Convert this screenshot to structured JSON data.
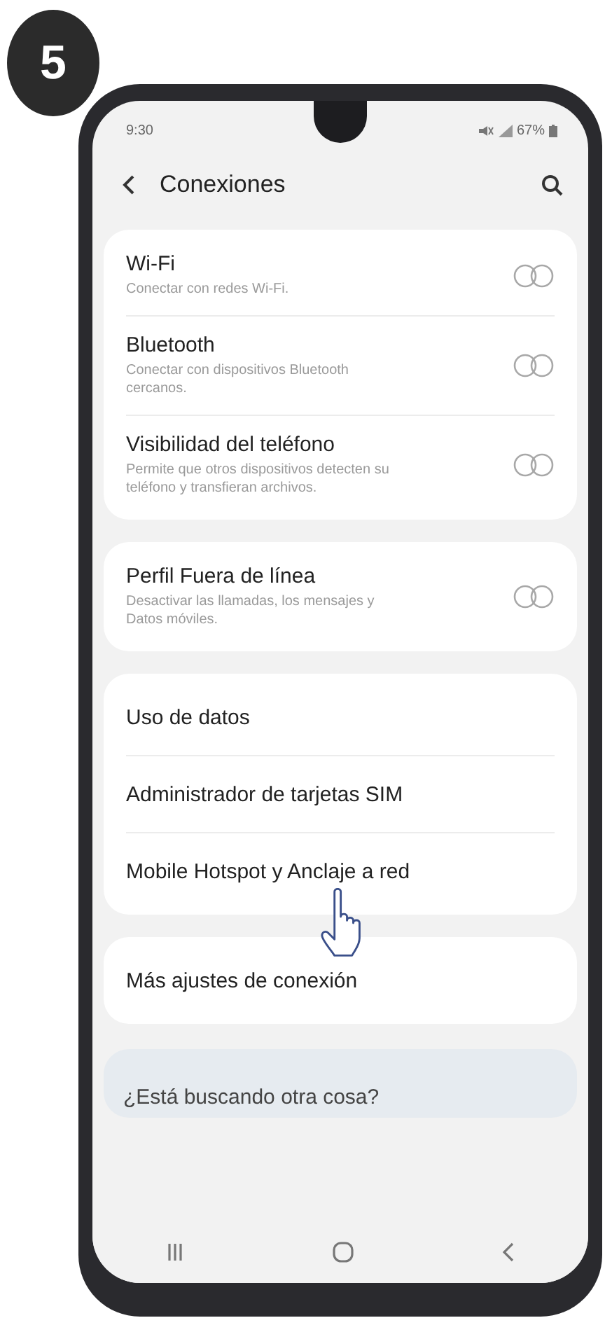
{
  "step_badge": "5",
  "status_bar": {
    "time": "9:30",
    "battery": "67%"
  },
  "header": {
    "title": "Conexiones"
  },
  "groups": [
    {
      "items": [
        {
          "kind": "toggle",
          "title": "Wi-Fi",
          "subtitle": "Conectar con redes Wi-Fi.",
          "on": false
        },
        {
          "kind": "toggle",
          "title": "Bluetooth",
          "subtitle": "Conectar con dispositivos Bluetooth cercanos.",
          "on": false
        },
        {
          "kind": "toggle",
          "title": "Visibilidad del teléfono",
          "subtitle": "Permite que otros dispositivos detecten su teléfono y transfieran archivos.",
          "on": false
        }
      ]
    },
    {
      "items": [
        {
          "kind": "toggle",
          "title": "Perfil Fuera de línea",
          "subtitle": "Desactivar las llamadas, los mensajes y Datos móviles.",
          "on": false
        }
      ]
    },
    {
      "items": [
        {
          "kind": "link",
          "title": "Uso de datos"
        },
        {
          "kind": "link",
          "title": "Administrador de tarjetas SIM"
        },
        {
          "kind": "link",
          "title": "Mobile Hotspot y Anclaje a red"
        }
      ]
    },
    {
      "items": [
        {
          "kind": "link",
          "title": "Más ajustes de conexión"
        }
      ]
    }
  ],
  "suggestion": {
    "title": "¿Está buscando otra cosa?"
  }
}
